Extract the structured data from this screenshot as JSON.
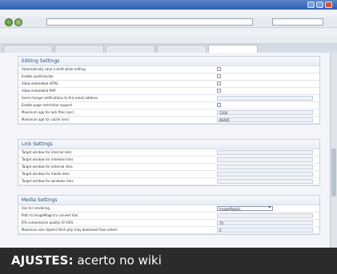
{
  "caption": {
    "lead": "AJUSTES:",
    "text": "acerto no wiki"
  },
  "sections": [
    {
      "title": "Editing Settings",
      "rows": [
        {
          "label": "Automatically save a draft while editing",
          "type": "checkbox"
        },
        {
          "label": "Enable spellchecker",
          "type": "checkbox"
        },
        {
          "label": "Allow embedded HTML",
          "type": "checkbox"
        },
        {
          "label": "Allow embedded PHP",
          "type": "checkbox"
        },
        {
          "label": "Send change notifications to this email address",
          "type": "text",
          "value": ""
        },
        {
          "label": "Enable page restriction support",
          "type": "checkbox"
        },
        {
          "label": "Maximum age for lock files (sec)",
          "type": "text",
          "value": "1200"
        },
        {
          "label": "Maximum age for cache (sec)",
          "type": "text",
          "value": "86400"
        }
      ]
    },
    {
      "title": "Link Settings",
      "rows": [
        {
          "label": "Target window for internal links",
          "type": "text",
          "value": ""
        },
        {
          "label": "Target window for interwiki links",
          "type": "text",
          "value": ""
        },
        {
          "label": "Target window for external links",
          "type": "text",
          "value": ""
        },
        {
          "label": "Target window for media links",
          "type": "text",
          "value": ""
        },
        {
          "label": "Target window for windows links",
          "type": "text",
          "value": ""
        }
      ]
    },
    {
      "title": "Media Settings",
      "rows": [
        {
          "label": "Use for rendering",
          "type": "select",
          "value": "ImageMagick"
        },
        {
          "label": "Path to ImageMagick's convert tool",
          "type": "text",
          "value": ""
        },
        {
          "label": "JPG compression quality (0-100)",
          "type": "text",
          "value": "70"
        },
        {
          "label": "Maximum size (bytes) fetch.php may download from extern",
          "type": "text",
          "value": "0"
        }
      ]
    }
  ]
}
